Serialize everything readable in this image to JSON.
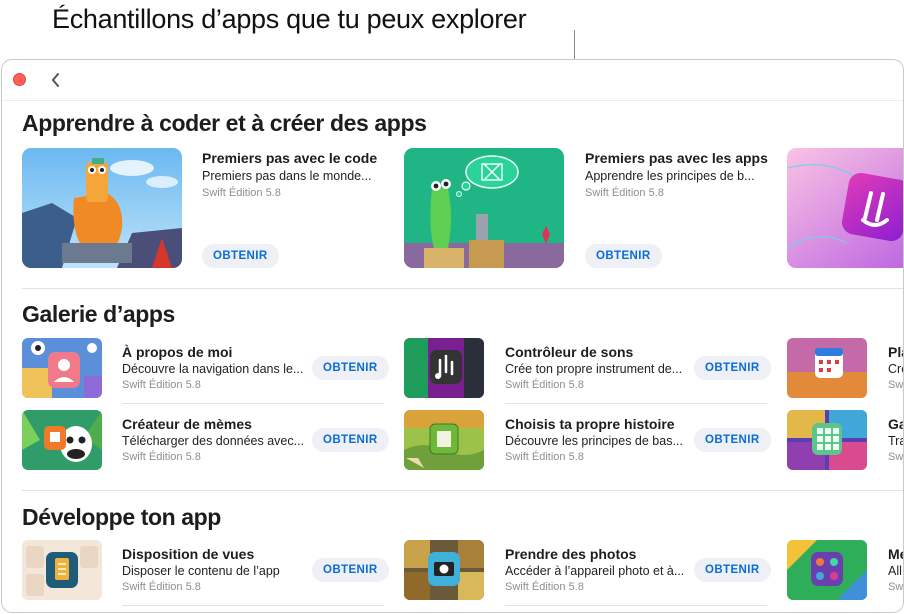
{
  "callout": "Échantillons d’apps que tu peux explorer",
  "sections": {
    "learn": {
      "title": "Apprendre à coder et à créer des apps",
      "items": [
        {
          "name": "Premiers pas avec le code",
          "desc": "Premiers pas dans le monde...",
          "edition": "Swift Édition 5.8",
          "button": "OBTENIR"
        },
        {
          "name": "Premiers pas avec les apps",
          "desc": "Apprendre les principes de b...",
          "edition": "Swift Édition 5.8",
          "button": "OBTENIR"
        }
      ]
    },
    "gallery": {
      "title": "Galerie d’apps",
      "items": [
        {
          "name": "À propos de moi",
          "desc": "Découvre la navigation dans le...",
          "edition": "Swift Édition 5.8",
          "button": "OBTENIR"
        },
        {
          "name": "Contrôleur de sons",
          "desc": "Crée ton propre instrument de...",
          "edition": "Swift Édition 5.8",
          "button": "OBTENIR"
        },
        {
          "name": "Pla",
          "desc": "Cré",
          "edition": "Swi"
        },
        {
          "name": "Créateur de mèmes",
          "desc": "Télécharger des données avec...",
          "edition": "Swift Édition 5.8",
          "button": "OBTENIR"
        },
        {
          "name": "Choisis ta propre histoire",
          "desc": "Découvre les principes de bas...",
          "edition": "Swift Édition 5.8",
          "button": "OBTENIR"
        },
        {
          "name": "Ga",
          "desc": "Tra",
          "edition": "Swi"
        }
      ]
    },
    "develop": {
      "title": "Développe ton app",
      "items": [
        {
          "name": "Disposition de vues",
          "desc": "Disposer le contenu de l’app",
          "edition": "Swift Édition 5.8",
          "button": "OBTENIR"
        },
        {
          "name": "Prendre des photos",
          "desc": "Accéder à l’appareil photo et à...",
          "edition": "Swift Édition 5.8",
          "button": "OBTENIR"
        },
        {
          "name": "Me",
          "desc": "All",
          "edition": "Swi"
        }
      ]
    }
  },
  "colors": {
    "accent": "#0a6cd6",
    "close": "#ff5f57",
    "button_bg": "#eef0f5"
  }
}
